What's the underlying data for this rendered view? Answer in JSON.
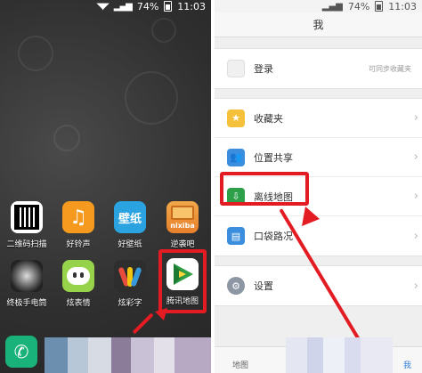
{
  "left_phone": {
    "status": {
      "battery": "74%",
      "time": "11:03"
    },
    "apps": [
      {
        "id": "qr",
        "label": "二维码扫描"
      },
      {
        "id": "ring",
        "label": "好铃声"
      },
      {
        "id": "paper",
        "label": "好壁纸",
        "glyph": "壁纸"
      },
      {
        "id": "nixiba",
        "label": "逆袭吧",
        "glyph": "nixiba"
      },
      {
        "id": "torch",
        "label": "终极手电筒"
      },
      {
        "id": "chat",
        "label": "炫表情"
      },
      {
        "id": "colorful",
        "label": "炫彩字"
      },
      {
        "id": "tmap",
        "label": "腾讯地图"
      }
    ],
    "colors": {
      "highlight": "#e31b23"
    }
  },
  "right_phone": {
    "status": {
      "battery": "74%",
      "time": "11:03"
    },
    "title": "我",
    "login": {
      "label": "登录",
      "hint": "可同步收藏夹"
    },
    "items": [
      {
        "label": "收藏夹",
        "icon": "star-icon"
      },
      {
        "label": "位置共享",
        "icon": "people-icon"
      },
      {
        "label": "离线地图",
        "icon": "download-icon"
      },
      {
        "label": "口袋路况",
        "icon": "traffic-icon"
      }
    ],
    "settings": {
      "label": "设置",
      "icon": "gear-icon"
    },
    "bottom_tabs": [
      "地图",
      "我"
    ]
  }
}
